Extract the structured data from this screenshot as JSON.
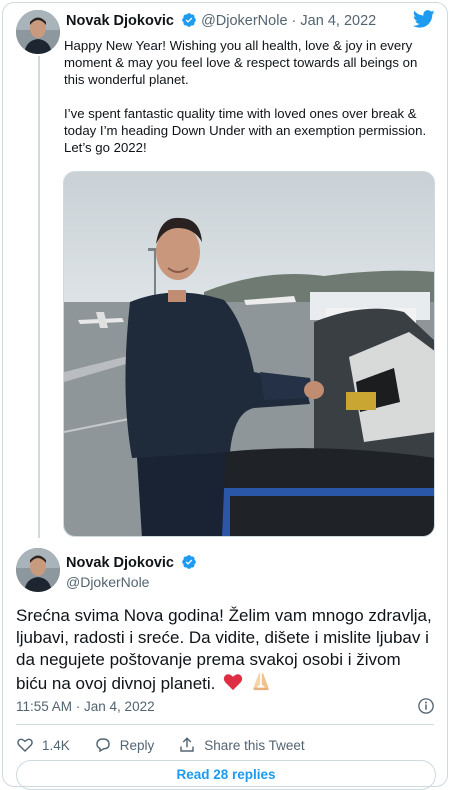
{
  "tweet1": {
    "author_name": "Novak Djokovic",
    "handle": "@DjokerNole",
    "separator": "·",
    "date": "Jan 4, 2022",
    "paragraph1": "Happy New Year! Wishing you all health, love & joy in every moment & may you feel love & respect towards all beings on this wonderful planet.",
    "paragraph2": "I’ve spent fantastic quality time with loved ones over break & today I’m heading Down Under with an exemption permission. Let’s go 2022!"
  },
  "tweet2": {
    "author_name": "Novak Djokovic",
    "handle": "@DjokerNole",
    "text": "Srećna svima Nova godina! Želim vam mnogo zdravlja, ljubavi, radosti i sreće. Da vidite, dišete i mislite ljubav i da negujete poštovanje prema svakoj osobi i živom biću na ovoj divnoj planeti.",
    "timestamp": "11:55 AM · Jan 4, 2022"
  },
  "actions": {
    "like_count": "1.4K",
    "reply_label": "Reply",
    "share_label": "Share this Tweet"
  },
  "read_replies_label": "Read 28 replies",
  "icons": {
    "brand": "twitter-bird-icon",
    "verified": "verified-badge-icon",
    "info": "info-icon",
    "like": "heart-icon",
    "reply": "reply-icon",
    "share": "share-icon"
  },
  "colors": {
    "accent": "#1d9bf0",
    "secondary_text": "#536471",
    "border": "#cfd9de"
  }
}
